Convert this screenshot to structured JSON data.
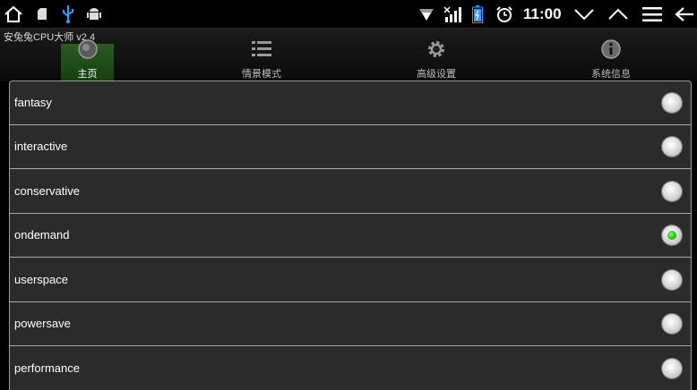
{
  "status_bar": {
    "time": "11:00",
    "icons": [
      "home-icon",
      "sd-card-icon",
      "usb-icon",
      "android-debug-icon",
      "wifi-icon",
      "signal-no-sim-icon",
      "battery-charging-icon",
      "alarm-icon",
      "chevron-down-icon",
      "chevron-up-icon",
      "menu-icon",
      "back-icon"
    ]
  },
  "app": {
    "title": "安兔兔CPU大师 v2.4"
  },
  "tabs": [
    {
      "label": "主页",
      "icon": "home-circle-icon",
      "active": true
    },
    {
      "label": "情景模式",
      "icon": "list-icon",
      "active": false
    },
    {
      "label": "高级设置",
      "icon": "gear-icon",
      "active": false
    },
    {
      "label": "系统信息",
      "icon": "info-icon",
      "active": false
    }
  ],
  "governors": [
    {
      "label": "fantasy",
      "selected": false
    },
    {
      "label": "interactive",
      "selected": false
    },
    {
      "label": "conservative",
      "selected": false
    },
    {
      "label": "ondemand",
      "selected": true
    },
    {
      "label": "userspace",
      "selected": false
    },
    {
      "label": "powersave",
      "selected": false
    },
    {
      "label": "performance",
      "selected": false
    }
  ],
  "colors": {
    "accent_green": "#22c016",
    "tab_active": "#1f4d17",
    "panel": "#2b2b2b"
  }
}
